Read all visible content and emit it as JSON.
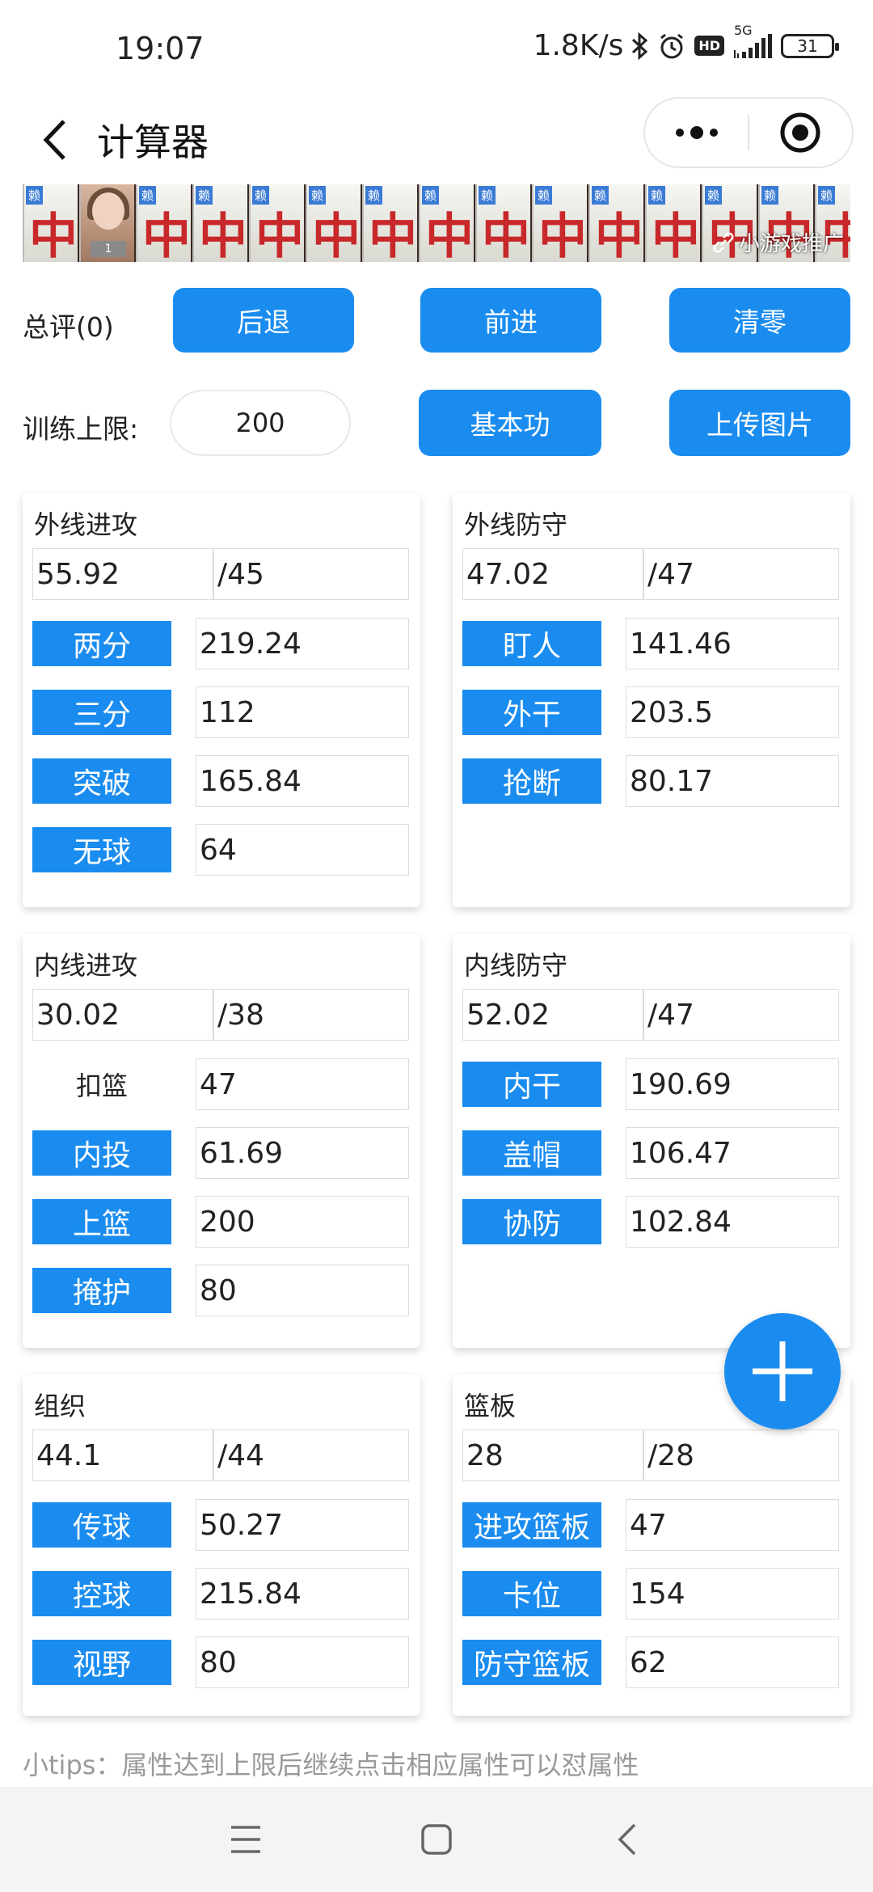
{
  "status_bar": {
    "time": "19:07",
    "network_speed": "1.8K/s",
    "signal_label": "5G",
    "hd_label": "HD",
    "battery": "31"
  },
  "header": {
    "title": "计算器"
  },
  "banner": {
    "tile_char": "中",
    "tile_tag": "赖",
    "avatar_number": "1",
    "promo_text": "小游戏推广"
  },
  "controls": {
    "score_label": "总评(0)",
    "back_label": "后退",
    "forward_label": "前进",
    "clear_label": "清零",
    "limit_label": "训练上限:",
    "limit_value": "200",
    "basic_label": "基本功",
    "upload_label": "上传图片"
  },
  "cards": [
    {
      "title": "外线进攻",
      "value": "55.92",
      "max": "/45",
      "attrs": [
        {
          "label": "两分",
          "value": "219.24",
          "button": true
        },
        {
          "label": "三分",
          "value": "112",
          "button": true
        },
        {
          "label": "突破",
          "value": "165.84",
          "button": true
        },
        {
          "label": "无球",
          "value": "64",
          "button": true
        }
      ]
    },
    {
      "title": "外线防守",
      "value": "47.02",
      "max": "/47",
      "attrs": [
        {
          "label": "盯人",
          "value": "141.46",
          "button": true
        },
        {
          "label": "外干",
          "value": "203.5",
          "button": true
        },
        {
          "label": "抢断",
          "value": "80.17",
          "button": true
        }
      ]
    },
    {
      "title": "内线进攻",
      "value": "30.02",
      "max": "/38",
      "attrs": [
        {
          "label": "扣篮",
          "value": "47",
          "button": false
        },
        {
          "label": "内投",
          "value": "61.69",
          "button": true
        },
        {
          "label": "上篮",
          "value": "200",
          "button": true
        },
        {
          "label": "掩护",
          "value": "80",
          "button": true
        }
      ]
    },
    {
      "title": "内线防守",
      "value": "52.02",
      "max": "/47",
      "attrs": [
        {
          "label": "内干",
          "value": "190.69",
          "button": true
        },
        {
          "label": "盖帽",
          "value": "106.47",
          "button": true
        },
        {
          "label": "协防",
          "value": "102.84",
          "button": true
        }
      ]
    },
    {
      "title": "组织",
      "value": "44.1",
      "max": "/44",
      "attrs": [
        {
          "label": "传球",
          "value": "50.27",
          "button": true
        },
        {
          "label": "控球",
          "value": "215.84",
          "button": true
        },
        {
          "label": "视野",
          "value": "80",
          "button": true
        }
      ]
    },
    {
      "title": "篮板",
      "value": "28",
      "max": "/28",
      "attrs": [
        {
          "label": "进攻篮板",
          "value": "47",
          "button": true
        },
        {
          "label": "卡位",
          "value": "154",
          "button": true
        },
        {
          "label": "防守篮板",
          "value": "62",
          "button": true
        }
      ]
    }
  ],
  "tips": "小tips：属性达到上限后继续点击相应属性可以怼属性",
  "colors": {
    "accent": "#1a8cf0",
    "text": "#222222",
    "muted": "#999999"
  }
}
